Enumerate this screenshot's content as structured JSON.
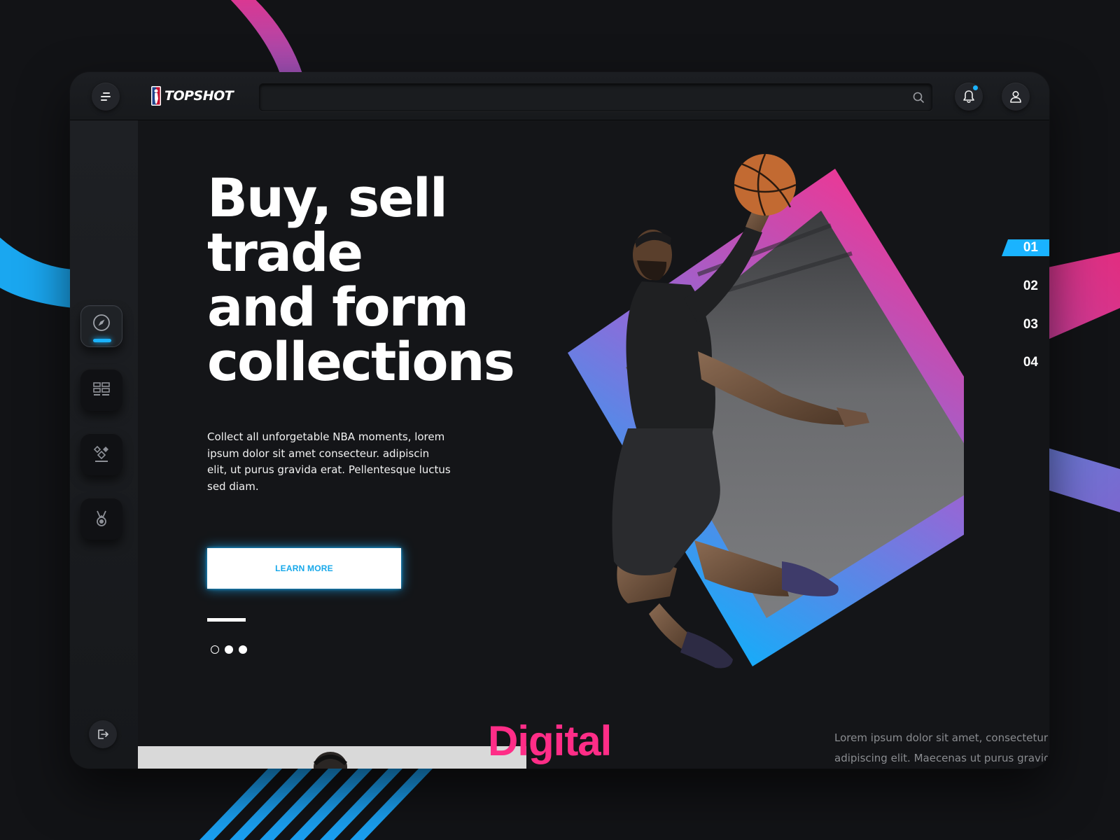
{
  "app": {
    "name": "Top Shot",
    "logo_text": "TOPSHOT"
  },
  "search": {
    "value": "",
    "placeholder": ""
  },
  "hero": {
    "title_line_1": "Buy, sell trade",
    "title_line_2": "and form",
    "title_line_3": "collections",
    "description": "Collect all unforgetable NBA moments, lorem ipsum dolor sit amet consecteur. adipiscin elit, ut purus gravida erat. Pellentesque luctus sed diam.",
    "cta_label": "LEARN MORE",
    "carousel_dots": 3,
    "active_dot": 0
  },
  "slide_nav": {
    "items": [
      "01",
      "02",
      "03",
      "04"
    ],
    "active": "01"
  },
  "bottom": {
    "heading": "Digital",
    "text": "Lorem ipsum dolor sit amet, consectetur adipiscing elit. Maecenas ut purus gravida erat"
  },
  "sidebar": {
    "items": [
      {
        "icon": "compass-icon",
        "active": true
      },
      {
        "icon": "dashboard-grid-icon",
        "active": false
      },
      {
        "icon": "diamond-cluster-icon",
        "active": false
      },
      {
        "icon": "medal-icon",
        "active": false
      }
    ]
  },
  "notifications": {
    "has_unread": true
  },
  "colors": {
    "accent_blue": "#1ab3ff",
    "accent_pink": "#ff2d87",
    "accent_purple": "#8f6ad8",
    "background": "#121316",
    "panel": "#141518"
  }
}
